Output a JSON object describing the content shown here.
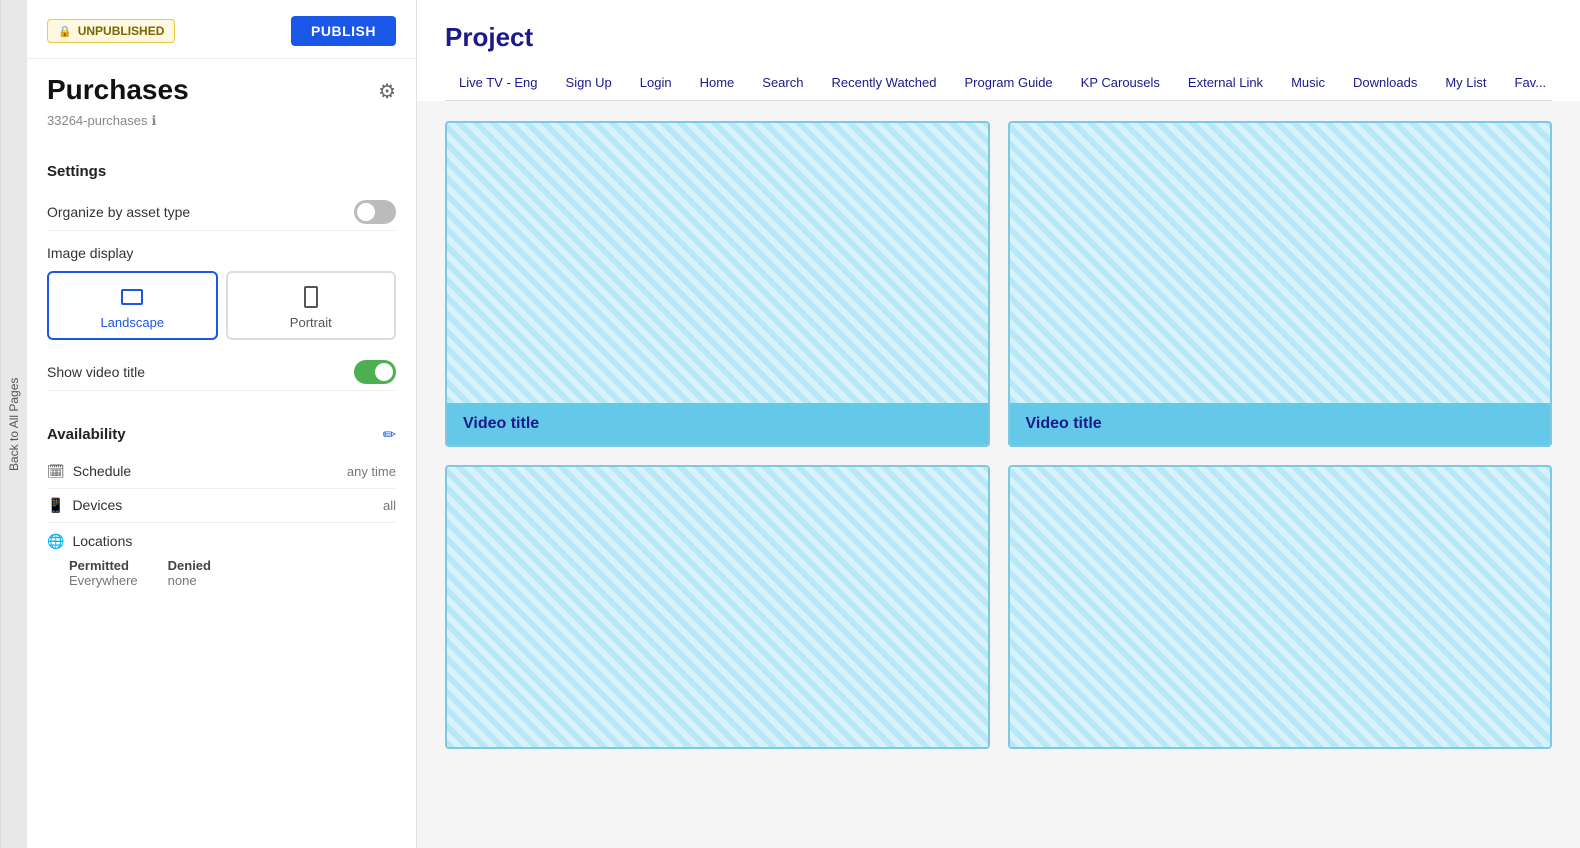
{
  "back_tab": "Back to All Pages",
  "status_badge": "UNPUBLISHED",
  "publish_btn": "PUBLISH",
  "page_name": "Purchases",
  "page_id": "33264-purchases",
  "settings": {
    "title": "Settings",
    "organize_label": "Organize by asset type",
    "organize_enabled": false,
    "image_display_label": "Image display",
    "landscape_label": "Landscape",
    "portrait_label": "Portrait",
    "show_video_title_label": "Show video title",
    "show_video_title_enabled": true
  },
  "availability": {
    "title": "Availability",
    "schedule_label": "Schedule",
    "schedule_value": "any time",
    "devices_label": "Devices",
    "devices_value": "all",
    "locations_label": "Locations",
    "permitted_label": "Permitted",
    "permitted_value": "Everywhere",
    "denied_label": "Denied",
    "denied_value": "none"
  },
  "project": {
    "title": "Project"
  },
  "nav_tabs": [
    "Live TV - Eng",
    "Sign Up",
    "Login",
    "Home",
    "Search",
    "Recently Watched",
    "Program Guide",
    "KP Carousels",
    "External Link",
    "Music",
    "Downloads",
    "My List",
    "Fav..."
  ],
  "videos": [
    {
      "title": "Video title"
    },
    {
      "title": "Video title"
    },
    {
      "title": ""
    },
    {
      "title": ""
    }
  ]
}
